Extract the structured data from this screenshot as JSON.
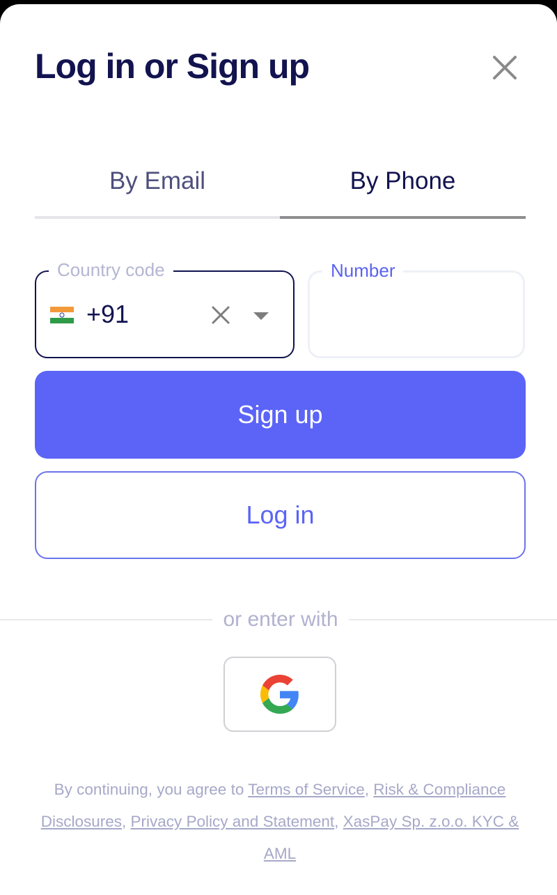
{
  "modal": {
    "title": "Log in or Sign up"
  },
  "tabs": [
    {
      "label": "By Email",
      "active": false
    },
    {
      "label": "By Phone",
      "active": true
    }
  ],
  "form": {
    "country_code_label": "Country code",
    "country_flag": "india-flag-icon",
    "country_dial_code": "+91",
    "number_label": "Number",
    "number_value": ""
  },
  "buttons": {
    "signup_label": "Sign up",
    "login_label": "Log in"
  },
  "divider": {
    "text": "or enter with"
  },
  "social": {
    "google_icon": "google-icon"
  },
  "legal": {
    "prefix": "By continuing, you agree to ",
    "links": [
      "Terms of Service",
      "Risk & Compliance Disclosures",
      "Privacy Policy and Statement",
      "XasPay Sp. z.o.o. KYC & AML"
    ],
    "separator": ", "
  },
  "colors": {
    "primary": "#5b64f7",
    "title": "#12134f",
    "muted": "#a6a8c8"
  }
}
